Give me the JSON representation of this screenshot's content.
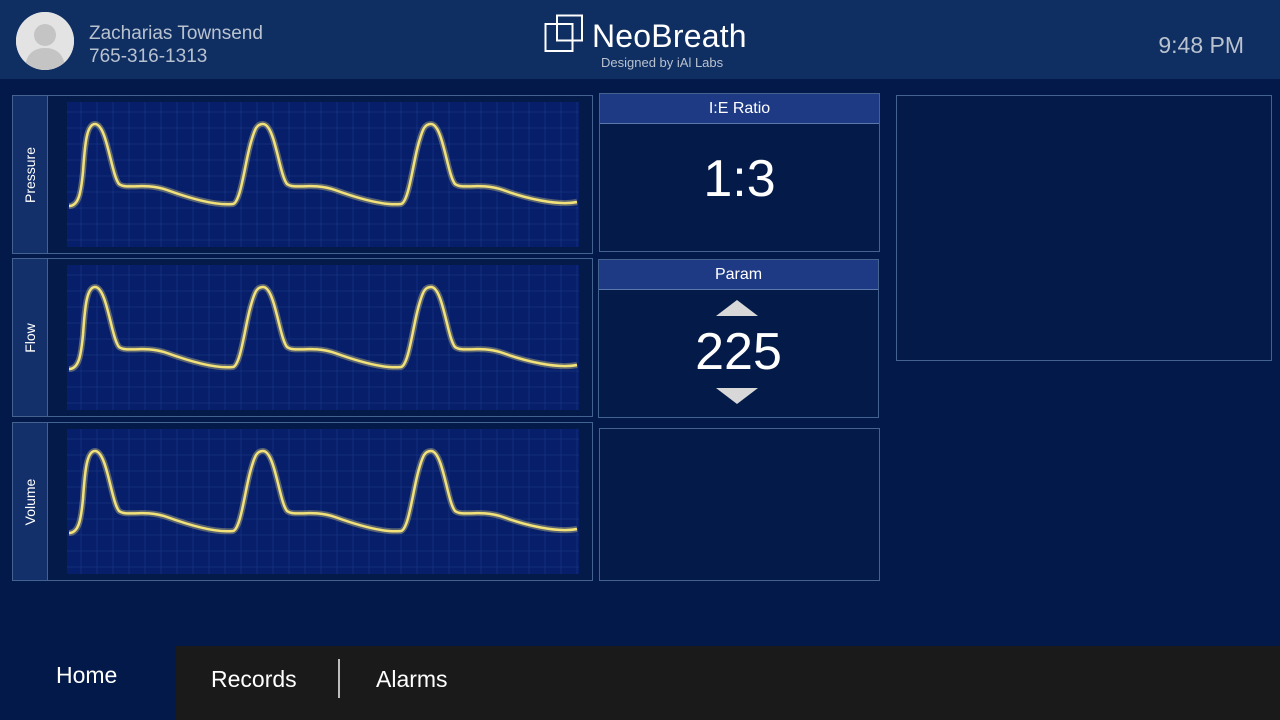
{
  "header": {
    "patient_name": "Zacharias Townsend",
    "patient_phone": "765-316-1313",
    "brand_name": "NeoBreath",
    "brand_subtitle": "Designed by iAl Labs",
    "time": "9:48 PM"
  },
  "waveforms": [
    {
      "label": "Pressure"
    },
    {
      "label": "Flow"
    },
    {
      "label": "Volume"
    }
  ],
  "ie_ratio": {
    "title": "I:E Ratio",
    "value": "1:3"
  },
  "param": {
    "title": "Param",
    "value": "225"
  },
  "nav": {
    "home": "Home",
    "records": "Records",
    "alarms": "Alarms"
  },
  "colors": {
    "background": "#03194a",
    "header": "#0f2e62",
    "waveform": "#f3e27a",
    "bottom_bar": "#1a1a1a"
  },
  "icons": {
    "avatar": "user-silhouette-icon",
    "logo": "overlapping-squares-logo-icon",
    "increase": "triangle-up-icon",
    "decrease": "triangle-down-icon"
  }
}
